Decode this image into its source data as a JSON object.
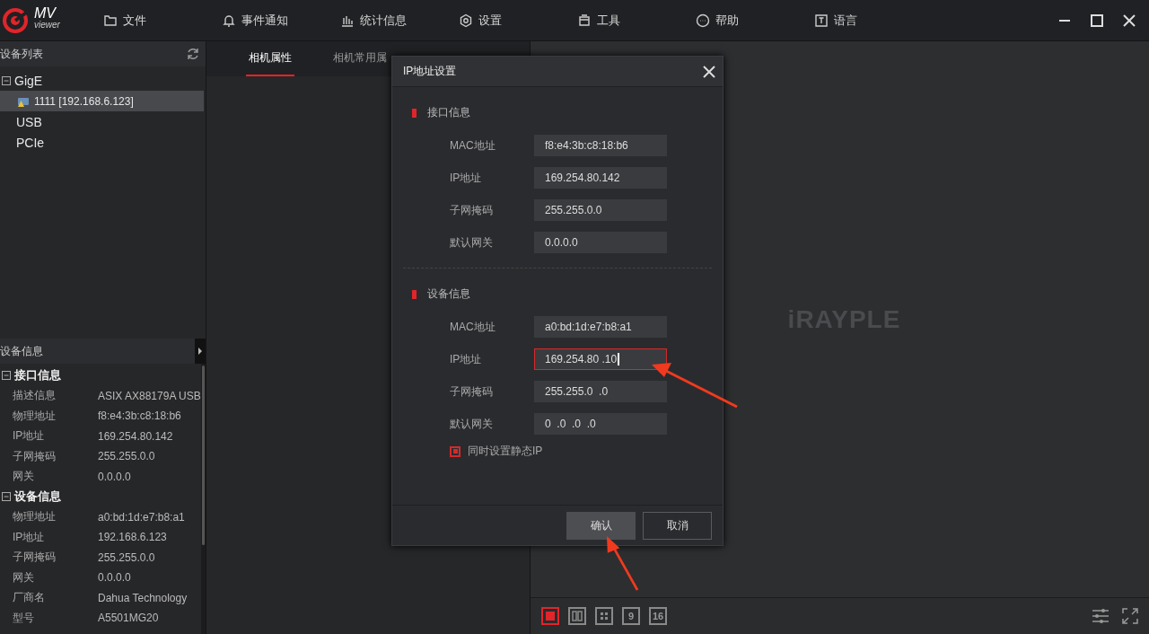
{
  "app": {
    "logo_main": "MV",
    "logo_sub": "viewer"
  },
  "menu": [
    {
      "kind": "folder",
      "label": "文件"
    },
    {
      "kind": "bell",
      "label": "事件通知"
    },
    {
      "kind": "bars",
      "label": "统计信息"
    },
    {
      "kind": "hexagon",
      "label": "设置"
    },
    {
      "kind": "case",
      "label": "工具"
    },
    {
      "kind": "dots",
      "label": "帮助"
    },
    {
      "kind": "letter",
      "label": "语言"
    }
  ],
  "device_list": {
    "title": "设备列表",
    "tree": [
      {
        "label": "GigE",
        "selected": false,
        "expanded": true,
        "children": [
          {
            "label": "1111 [192.168.6.123]",
            "selected": true
          }
        ]
      },
      {
        "label": "USB",
        "selected": false
      },
      {
        "label": "PCIe",
        "selected": false
      }
    ]
  },
  "device_info": {
    "title": "设备信息",
    "groups": [
      {
        "title": "接口信息",
        "expanded": true,
        "rows": [
          {
            "label": "描述信息",
            "value": "ASIX AX88179A USB"
          },
          {
            "label": "物理地址",
            "value": "f8:e4:3b:c8:18:b6"
          },
          {
            "label": "IP地址",
            "value": "169.254.80.142"
          },
          {
            "label": "子网掩码",
            "value": "255.255.0.0"
          },
          {
            "label": "网关",
            "value": "0.0.0.0"
          }
        ]
      },
      {
        "title": "设备信息",
        "expanded": true,
        "rows": [
          {
            "label": "物理地址",
            "value": "a0:bd:1d:e7:b8:a1"
          },
          {
            "label": "IP地址",
            "value": "192.168.6.123"
          },
          {
            "label": "子网掩码",
            "value": "255.255.0.0"
          },
          {
            "label": "网关",
            "value": "0.0.0.0"
          },
          {
            "label": "厂商名",
            "value": "Dahua Technology"
          },
          {
            "label": "型号",
            "value": "A5501MG20"
          }
        ]
      }
    ]
  },
  "tabs": [
    {
      "label": "相机属性",
      "selected": true
    },
    {
      "label": "相机常用属",
      "selected": false
    }
  ],
  "viewer": {
    "brand": "iRAYPLE",
    "layouts": [
      {
        "kind": "single",
        "selected": true
      },
      {
        "kind": "two",
        "selected": false
      },
      {
        "kind": "four",
        "selected": false
      },
      {
        "kind": "number",
        "label": "9",
        "selected": false
      },
      {
        "kind": "number",
        "label": "16",
        "selected": false
      }
    ]
  },
  "dialog": {
    "title": "IP地址设置",
    "sections": [
      {
        "title": "接口信息",
        "fields": [
          {
            "label": "MAC地址",
            "value": "f8:e4:3b:c8:18:b6",
            "focused": false
          },
          {
            "label": "IP地址",
            "value": "169.254.80.142",
            "focused": false
          },
          {
            "label": "子网掩码",
            "value": "255.255.0.0",
            "focused": false
          },
          {
            "label": "默认网关",
            "value": "0.0.0.0",
            "focused": false
          }
        ]
      },
      {
        "title": "设备信息",
        "fields": [
          {
            "label": "MAC地址",
            "value": "a0:bd:1d:e7:b8:a1",
            "focused": false
          },
          {
            "label": "IP地址",
            "value": "169.254.80 .10",
            "focused": true
          },
          {
            "label": "子网掩码",
            "value": "255.255.0  .0",
            "focused": false
          },
          {
            "label": "默认网关",
            "value": "0  .0  .0  .0",
            "focused": false
          }
        ]
      }
    ],
    "static_ip": {
      "label": "同时设置静态IP",
      "checked": true
    },
    "buttons": [
      {
        "label": "确认",
        "kind": "primary"
      },
      {
        "label": "取消",
        "kind": "secondary"
      }
    ]
  }
}
